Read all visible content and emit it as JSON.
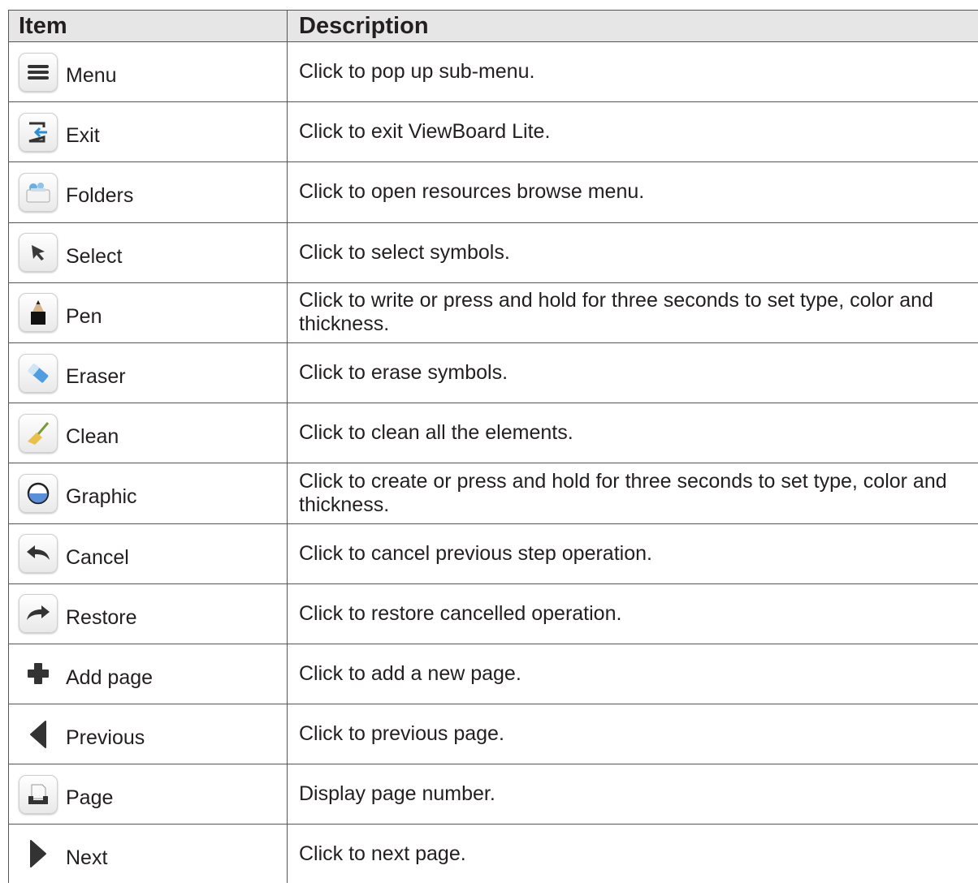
{
  "table": {
    "headers": {
      "item": "Item",
      "description": "Description"
    },
    "rows": [
      {
        "icon": "menu-icon",
        "item": "Menu",
        "description": "Click to pop up sub-menu."
      },
      {
        "icon": "exit-icon",
        "item": "Exit",
        "description": "Click to exit ViewBoard Lite."
      },
      {
        "icon": "folders-icon",
        "item": "Folders",
        "description": "Click to open resources browse menu."
      },
      {
        "icon": "select-arrow-icon",
        "item": "Select",
        "description": "Click to select symbols."
      },
      {
        "icon": "pen-pencil-icon",
        "item": "Pen",
        "description": "Click to write or press and hold for three seconds to set type, color and thickness."
      },
      {
        "icon": "eraser-icon",
        "item": "Eraser",
        "description": "Click to erase symbols."
      },
      {
        "icon": "clean-broom-icon",
        "item": "Clean",
        "description": "Click to clean all the elements."
      },
      {
        "icon": "graphic-circle-icon",
        "item": "Graphic",
        "description": "Click to create or press and hold for three seconds to set type, color and thickness."
      },
      {
        "icon": "cancel-undo-icon",
        "item": "Cancel",
        "description": "Click to cancel previous step operation."
      },
      {
        "icon": "restore-redo-icon",
        "item": "Restore",
        "description": "Click to restore cancelled operation."
      },
      {
        "icon": "add-page-plus-icon",
        "item": "Add page",
        "description": "Click to add a new page."
      },
      {
        "icon": "previous-triangle-icon",
        "item": "Previous",
        "description": "Click to previous page."
      },
      {
        "icon": "page-tray-icon",
        "item": "Page",
        "description": "Display page number."
      },
      {
        "icon": "next-triangle-icon",
        "item": "Next",
        "description": "Click to next page."
      }
    ]
  }
}
